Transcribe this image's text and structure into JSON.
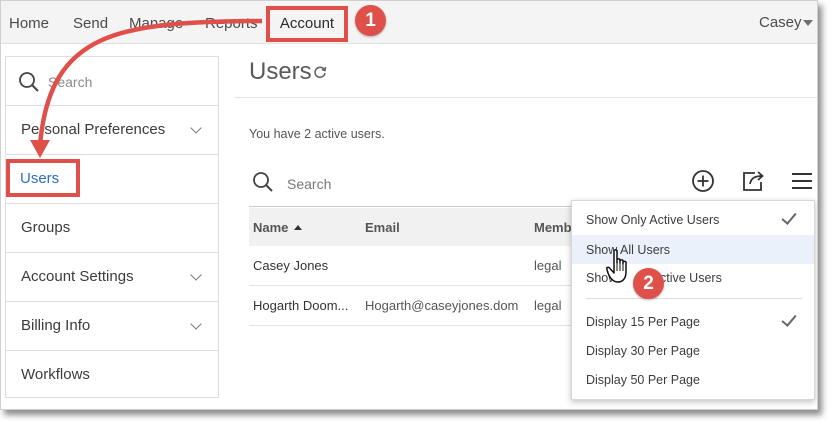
{
  "topnav": {
    "items": [
      "Home",
      "Send",
      "Manage",
      "Reports"
    ],
    "active": "Account",
    "user": "Casey"
  },
  "callouts": [
    "1",
    "2"
  ],
  "sidebar": {
    "search_placeholder": "Search",
    "items": [
      {
        "label": "Personal Preferences"
      },
      {
        "label": "Users"
      },
      {
        "label": "Groups"
      },
      {
        "label": "Account Settings"
      },
      {
        "label": "Billing Info"
      },
      {
        "label": "Workflows"
      }
    ]
  },
  "main": {
    "title": "Users",
    "active_users_text": "You have 2 active users.",
    "search_placeholder": "Search",
    "table": {
      "headers": {
        "name": "Name",
        "email": "Email",
        "membership": "Memb"
      },
      "rows": [
        {
          "name": "Casey Jones",
          "email": "",
          "membership": "legal"
        },
        {
          "name": "Hogarth Doom...",
          "email": "Hogarth@caseyjones.dom",
          "membership": "legal"
        }
      ]
    }
  },
  "dropdown": {
    "items": [
      {
        "label": "Show Only Active Users",
        "checked": true
      },
      {
        "label": "Show All Users",
        "checked": false
      },
      {
        "label": "Show",
        "checked": false,
        "label_tail": "ctive Users"
      },
      {
        "label": "Display 15 Per Page",
        "checked": true
      },
      {
        "label": "Display 30 Per Page",
        "checked": false
      },
      {
        "label": "Display 50 Per Page",
        "checked": false
      }
    ]
  },
  "colors": {
    "callout": "#e0504a",
    "active_link": "#2c6fbf",
    "hover_row": "#eaf1fa"
  }
}
